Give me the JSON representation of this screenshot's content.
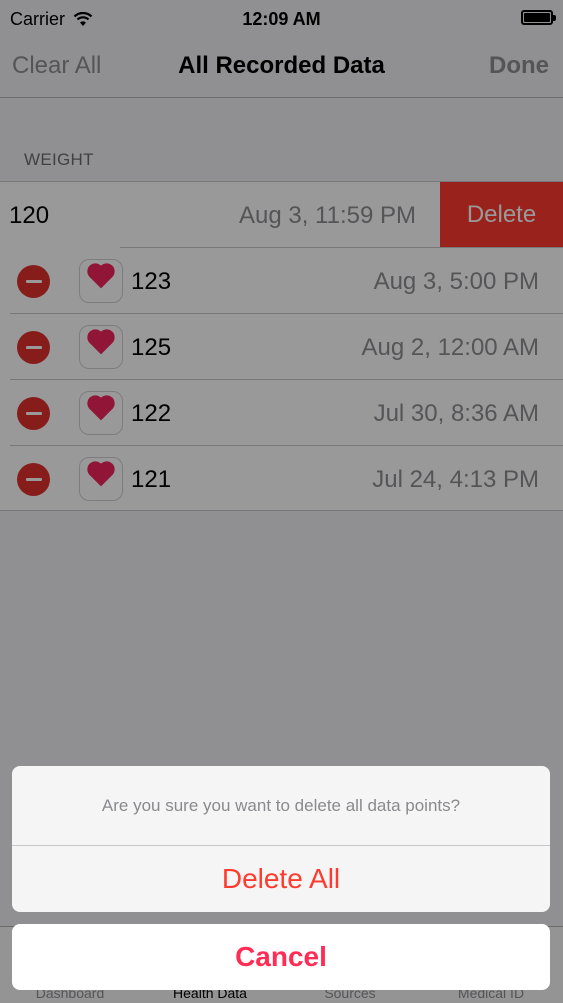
{
  "status_bar": {
    "carrier": "Carrier",
    "time": "12:09 AM"
  },
  "nav": {
    "left": "Clear All",
    "title": "All Recorded Data",
    "right": "Done"
  },
  "section": {
    "header": "WEIGHT"
  },
  "swiped_row": {
    "value": "120",
    "date": "Aug 3, 11:59 PM",
    "delete_label": "Delete"
  },
  "rows": [
    {
      "value": "123",
      "date": "Aug 3, 5:00 PM"
    },
    {
      "value": "125",
      "date": "Aug 2, 12:00 AM"
    },
    {
      "value": "122",
      "date": "Jul 30, 8:36 AM"
    },
    {
      "value": "121",
      "date": "Jul 24, 4:13 PM"
    }
  ],
  "tabs": [
    "Dashboard",
    "Health Data",
    "Sources",
    "Medical ID"
  ],
  "action_sheet": {
    "message": "Are you sure you want to delete all data points?",
    "destructive": "Delete All",
    "cancel": "Cancel"
  },
  "colors": {
    "destructive": "#ff3b30",
    "cancel": "#ff2d55",
    "heart": "#f0245d"
  },
  "icons": {
    "wifi": "wifi-icon",
    "battery": "battery-icon",
    "heart": "heart-icon",
    "minus": "minus-circle-icon"
  }
}
